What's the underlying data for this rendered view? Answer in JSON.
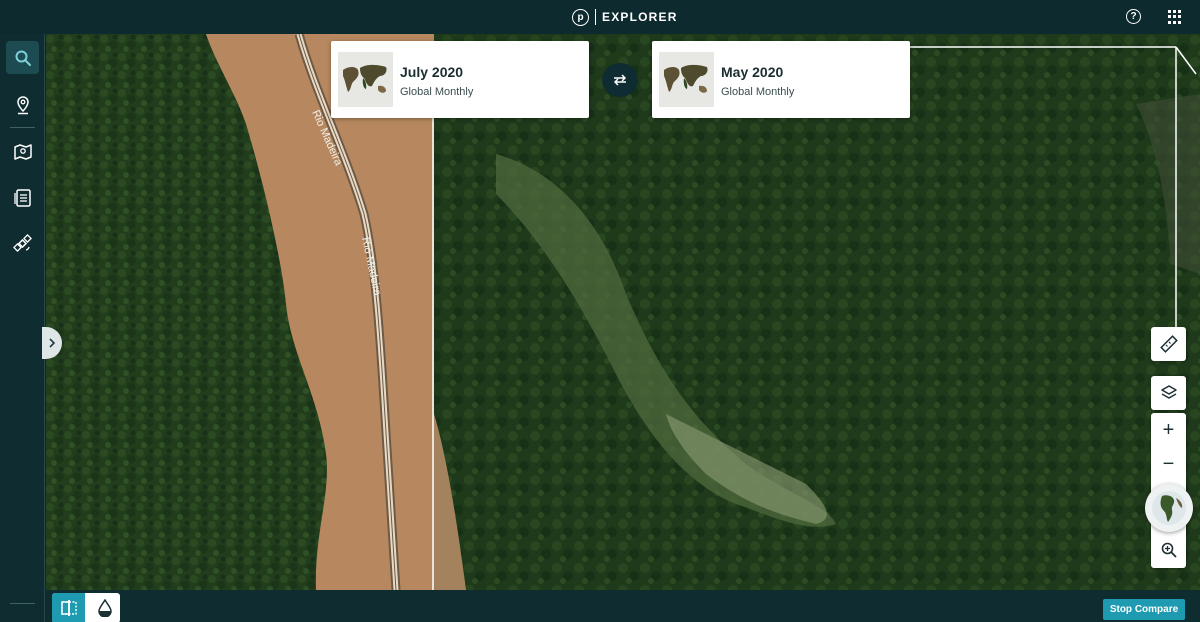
{
  "header": {
    "logo_letter": "p",
    "title": "EXPLORER",
    "help_icon": "question-circle-icon",
    "apps_icon": "grid-apps-icon"
  },
  "sidebar": {
    "items": [
      {
        "name": "search-icon",
        "active": true
      },
      {
        "name": "location-pin-icon",
        "active": false
      },
      {
        "name": "map-area-icon",
        "active": false
      },
      {
        "name": "list-document-icon",
        "active": false
      },
      {
        "name": "satellite-icon",
        "active": false
      }
    ]
  },
  "map": {
    "river_labels": [
      "Rio Madeira",
      "Rio Madeira"
    ]
  },
  "compare": {
    "left": {
      "title": "July 2020",
      "subtitle": "Global Monthly"
    },
    "right": {
      "title": "May 2020",
      "subtitle": "Global Monthly"
    },
    "swap_icon": "swap-arrows-icon"
  },
  "controls": {
    "measure_icon": "ruler-icon",
    "layers_icon": "layers-icon",
    "zoom_in": "+",
    "zoom_out": "−",
    "globe_icon": "globe-icon",
    "zoom_to_icon": "zoom-search-icon"
  },
  "bottom": {
    "compare_icon": "compare-split-icon",
    "drop_icon": "water-drop-icon",
    "stop_compare_label": "Stop Compare"
  },
  "colors": {
    "accent": "#1e9bb0",
    "dark": "#0f2c31"
  }
}
